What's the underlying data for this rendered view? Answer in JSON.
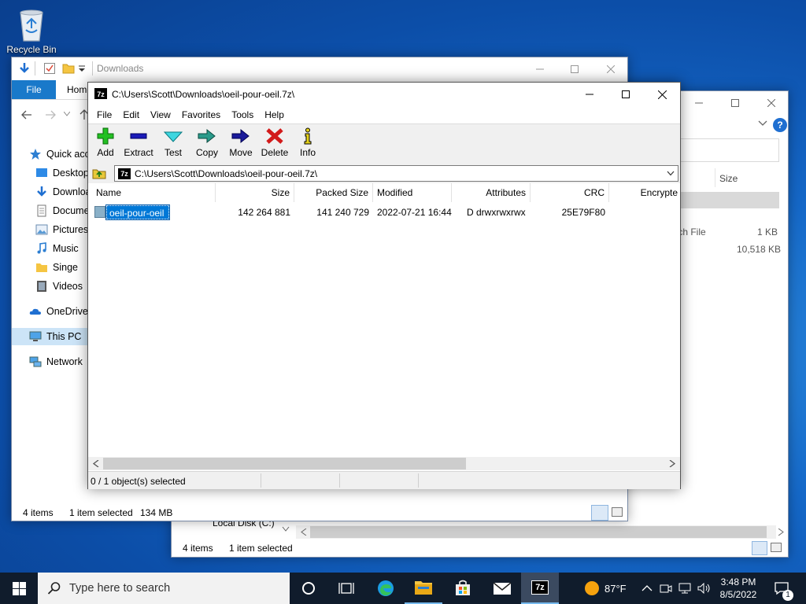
{
  "desktop": {
    "recycle_bin_label": "Recycle Bin"
  },
  "explorer_a": {
    "title": "Downloads",
    "ribbon_tab_file": "File",
    "ribbon_tab_home": "Home",
    "nav_quick_access": "Quick acc",
    "nav_desktop": "Desktop",
    "nav_downloads": "Downloa",
    "nav_documents": "Docume",
    "nav_pictures": "Pictures",
    "nav_music": "Music",
    "nav_singe": "Singe",
    "nav_videos": "Videos",
    "nav_onedrive": "OneDrive",
    "nav_this_pc": "This PC",
    "nav_network": "Network",
    "status_items": "4 items",
    "status_selected": "1 item selected",
    "status_size": "134 MB"
  },
  "explorer_b": {
    "col_size": "Size",
    "row1_type": "tch File",
    "row1_size": "1 KB",
    "row2_size": "10,518 KB",
    "nav_local_disk": "Local Disk (C:)",
    "status_items": "4 items",
    "status_selected": "1 item selected"
  },
  "sevenzip": {
    "title": "C:\\Users\\Scott\\Downloads\\oeil-pour-oeil.7z\\",
    "menu": {
      "file": "File",
      "edit": "Edit",
      "view": "View",
      "favorites": "Favorites",
      "tools": "Tools",
      "help": "Help"
    },
    "toolbar": {
      "add": "Add",
      "extract": "Extract",
      "test": "Test",
      "copy": "Copy",
      "move": "Move",
      "delete": "Delete",
      "info": "Info"
    },
    "address": "C:\\Users\\Scott\\Downloads\\oeil-pour-oeil.7z\\",
    "columns": {
      "name": "Name",
      "size": "Size",
      "packed": "Packed Size",
      "modified": "Modified",
      "attributes": "Attributes",
      "crc": "CRC",
      "encrypted": "Encrypte"
    },
    "rows": [
      {
        "name": "oeil-pour-oeil",
        "size": "142 264 881",
        "packed": "141 240 729",
        "modified": "2022-07-21 16:44",
        "attributes": "D drwxrwxrwx",
        "crc": "25E79F80"
      }
    ],
    "status": "0 / 1 object(s) selected"
  },
  "taskbar": {
    "search_placeholder": "Type here to search",
    "weather": "87°F",
    "time": "3:48 PM",
    "date": "8/5/2022",
    "notification_count": "1"
  },
  "colors": {
    "accent": "#0078d7",
    "selection": "#3399ff",
    "taskbar": "#101c2c"
  }
}
